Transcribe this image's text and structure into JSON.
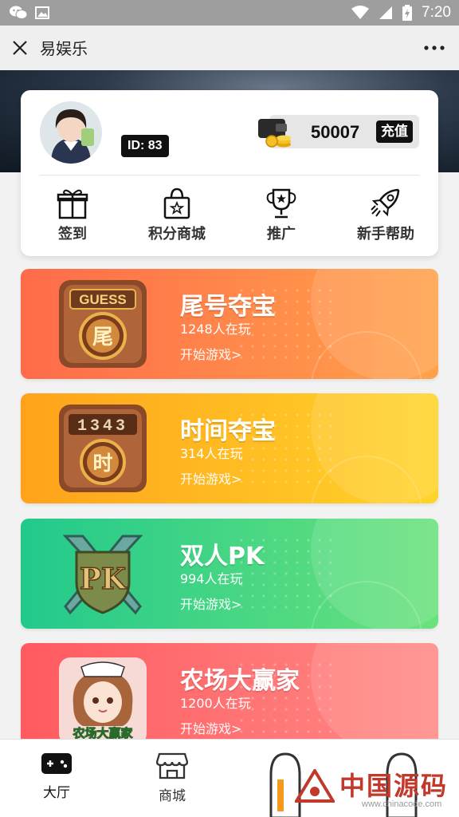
{
  "status_bar": {
    "time": "7:20",
    "left_icons": [
      "wechat-icon",
      "image-icon"
    ],
    "right_icons": [
      "wifi-icon",
      "signal-icon",
      "battery-icon"
    ]
  },
  "title_bar": {
    "title": "易娱乐",
    "close_icon": "close-icon",
    "more_icon": "more-icon"
  },
  "profile": {
    "id_label": "ID: 83",
    "coins": "50007",
    "recharge_label": "充值"
  },
  "quick_actions": [
    {
      "label": "签到",
      "icon": "gift-icon"
    },
    {
      "label": "积分商城",
      "icon": "shopping-bag-icon"
    },
    {
      "label": "推广",
      "icon": "trophy-icon"
    },
    {
      "label": "新手帮助",
      "icon": "rocket-icon"
    }
  ],
  "games": [
    {
      "name": "尾号夺宝",
      "players": "1248人在玩",
      "start": "开始游戏>",
      "icon_text": "GUESS",
      "icon_char": "尾",
      "colors": [
        "#ff6b4a",
        "#ffa24a"
      ]
    },
    {
      "name": "时间夺宝",
      "players": "314人在玩",
      "start": "开始游戏>",
      "icon_text": "1343",
      "icon_char": "时",
      "colors": [
        "#ffa21a",
        "#ffd42a"
      ]
    },
    {
      "name": "双人PK",
      "players": "994人在玩",
      "start": "开始游戏>",
      "icon_text": "PK",
      "icon_char": "",
      "colors": [
        "#22c98c",
        "#6ae27c"
      ]
    },
    {
      "name": "农场大赢家",
      "players": "1200人在玩",
      "start": "开始游戏>",
      "icon_text": "农场大赢家",
      "icon_char": "",
      "colors": [
        "#ff5a60",
        "#ff8a86"
      ]
    }
  ],
  "bottom_nav": [
    {
      "label": "大厅",
      "icon": "gamepad-icon",
      "active": true
    },
    {
      "label": "商城",
      "icon": "store-icon",
      "active": false
    }
  ],
  "watermark": {
    "text": "中国源码",
    "url": "www.chinacode.com"
  }
}
